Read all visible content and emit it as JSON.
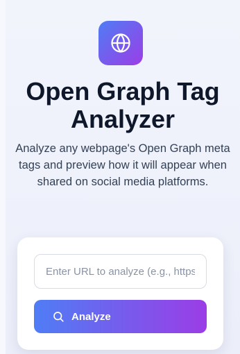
{
  "hero": {
    "title": "Open Graph Tag Analyzer",
    "subtitle": "Analyze any webpage's Open Graph meta tags and preview how it will appear when shared on social media platforms."
  },
  "form": {
    "url_placeholder": "Enter URL to analyze (e.g., https://example.com)",
    "url_value": "",
    "analyze_label": "Analyze"
  },
  "icons": {
    "logo": "globe-icon",
    "button": "search-icon"
  },
  "colors": {
    "gradient_start": "#4f7df5",
    "gradient_end": "#9b3de6",
    "title": "#0f172a",
    "subtitle": "#334155"
  }
}
